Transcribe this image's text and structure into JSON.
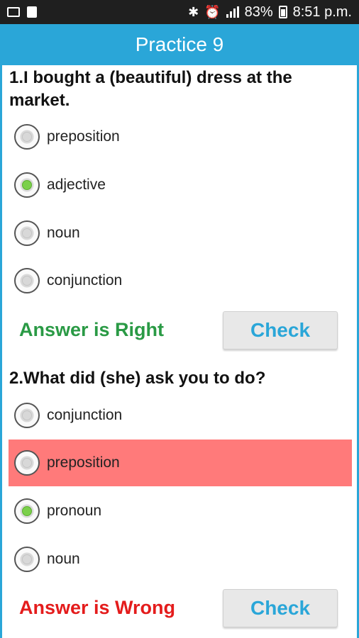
{
  "status_bar": {
    "battery": "83%",
    "time": "8:51 p.m.",
    "icons": [
      "mail-icon",
      "bag-icon",
      "bluetooth-icon",
      "alarm-icon",
      "signal-icon",
      "battery-icon"
    ]
  },
  "title": "Practice 9",
  "questions": [
    {
      "text": "1.I bought a (beautiful) dress at the market.",
      "options": [
        "preposition",
        "adjective",
        "noun",
        "conjunction"
      ],
      "selected": "adjective",
      "result": "Answer is Right",
      "check_label": "Check"
    },
    {
      "text": "2.What did (she) ask you to do?",
      "options": [
        "conjunction",
        "preposition",
        "pronoun",
        "noun"
      ],
      "selected": "pronoun",
      "highlighted_wrong": "preposition",
      "result": "Answer is Wrong",
      "check_label": "Check"
    }
  ],
  "colors": {
    "accent": "#2aa6d8",
    "right": "#2a9a45",
    "wrong": "#e41c1c",
    "wrong_highlight": "#ff7a7a",
    "radio_checked": "#7bd04b"
  }
}
